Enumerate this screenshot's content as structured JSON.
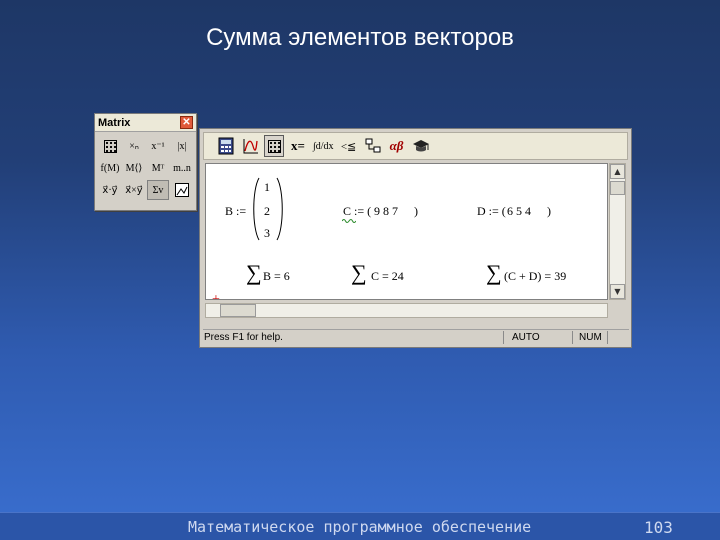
{
  "slide": {
    "title": "Сумма элементов векторов",
    "footer_text": "Математическое программное обеспечение",
    "page_number": "103"
  },
  "palette": {
    "title": "Matrix",
    "close_glyph": "✕",
    "buttons": [
      "",
      "×ₙ",
      "x⁻¹",
      "|x|",
      "f(M)",
      "M⟨⟩",
      "Mᵀ",
      "m..n",
      "x⃗·y⃗",
      "x⃗×y⃗",
      "Σv",
      ""
    ]
  },
  "toolbar": {
    "items": [
      "▦",
      "Ⱥ",
      "▦",
      "x=",
      "∫d/dx",
      "<≦",
      "⊟",
      "αβ",
      "☗"
    ]
  },
  "worksheet": {
    "b_label": "B :=",
    "b_values": [
      "1",
      "2",
      "3"
    ],
    "c_label": "C := (",
    "c_values": "9  8  7",
    "c_close": ")",
    "d_label": "D := (",
    "d_values": "6  5  4",
    "d_close": ")",
    "sum_symbol": "∑",
    "sum_b": "B = 6",
    "sum_c": "C = 24",
    "sum_cd": "(C + D) = 39",
    "cursor": "+"
  },
  "statusbar": {
    "help": "Press F1 for help.",
    "mode": "AUTO",
    "num": "NUM"
  },
  "colors": {
    "background_top": "#1e3766",
    "background_bottom": "#3a6fd0",
    "cursor_red": "#cc0000",
    "squiggle_green": "#2a8a2a"
  }
}
